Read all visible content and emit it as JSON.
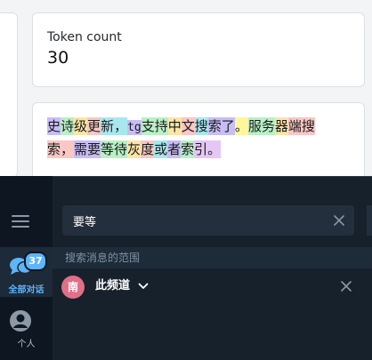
{
  "token_card": {
    "label": "Token count",
    "value": "30"
  },
  "tokens": [
    {
      "text": "史",
      "color": "#c8bdf5"
    },
    {
      "text": "诗",
      "color": "#b9f0c6"
    },
    {
      "text": "级",
      "color": "#fde5a6"
    },
    {
      "text": "更",
      "color": "#f9c7c4"
    },
    {
      "text": "新，",
      "color": "#a9e7f0"
    },
    {
      "text": "tg",
      "color": "#c8bdf5",
      "code": true
    },
    {
      "text": "支持",
      "color": "#b9f0c6"
    },
    {
      "text": "中",
      "color": "#fde5a6"
    },
    {
      "text": "文",
      "color": "#f9c7c4"
    },
    {
      "text": "搜",
      "color": "#a9e7f0"
    },
    {
      "text": "索了",
      "color": "#c8bdf5"
    },
    {
      "text": "。",
      "color": "#fff59d"
    },
    {
      "text": "服务",
      "color": "#b9f0c6"
    },
    {
      "text": "器",
      "color": "#fde5a6"
    },
    {
      "text": "端",
      "color": "#f9c7c4"
    },
    {
      "text": "搜",
      "color": "#f9c7c4"
    },
    {
      "text": "索，",
      "color": "#f9c7c4"
    },
    {
      "text": "需要",
      "color": "#c8bdf5"
    },
    {
      "text": "等待",
      "color": "#b9f0c6"
    },
    {
      "text": "灰",
      "color": "#fde5a6"
    },
    {
      "text": "度",
      "color": "#f9c7c4"
    },
    {
      "text": "或",
      "color": "#a9e7f0"
    },
    {
      "text": "者",
      "color": "#c8bdf5"
    },
    {
      "text": "索",
      "color": "#b9f0c6"
    },
    {
      "text": "引。",
      "color": "#e5c6f5"
    }
  ],
  "line_break_after": 16,
  "app": {
    "search_value": "要等",
    "scope_header": "搜索消息的范围",
    "scope": {
      "avatar_letter": "南",
      "name": "此频道"
    },
    "rail": {
      "chats_label": "全部对话",
      "chats_badge": "37",
      "personal_label": "个人"
    },
    "colors": {
      "accent": "#5eb5f7",
      "dark_bg": "#17212b",
      "avatar": "#e06f88"
    }
  }
}
